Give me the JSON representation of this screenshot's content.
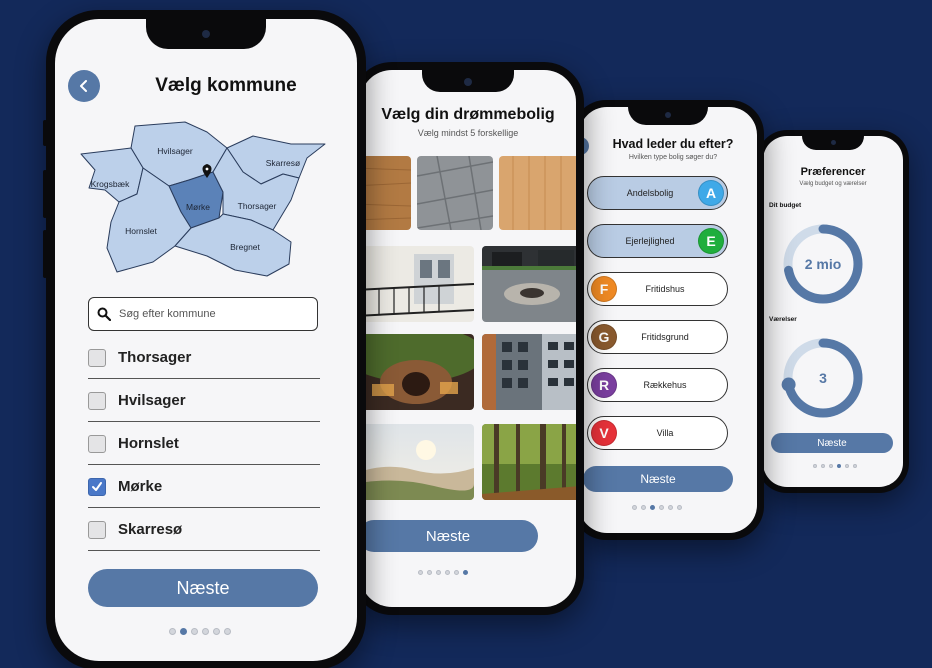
{
  "colors": {
    "background": "#13295a",
    "primary": "#5678a6",
    "map_fill": "#bcd0ea",
    "map_selected": "#5b82b8"
  },
  "screen1": {
    "title": "Vælg kommune",
    "back_icon": "chevron-left-icon",
    "map_regions": [
      "Hvilsager",
      "Skarresø",
      "Krogsbæk",
      "Mørke",
      "Thorsager",
      "Hornslet",
      "Bregnet"
    ],
    "map_pin_icon": "map-pin-icon",
    "search_placeholder": "Søg efter kommune",
    "search_icon": "search-icon",
    "items": [
      {
        "label": "Thorsager",
        "checked": false
      },
      {
        "label": "Hvilsager",
        "checked": false
      },
      {
        "label": "Hornslet",
        "checked": false
      },
      {
        "label": "Mørke",
        "checked": true
      },
      {
        "label": "Skarresø",
        "checked": false
      }
    ],
    "next_label": "Næste",
    "progress": {
      "total": 6,
      "active": 1
    }
  },
  "screen2": {
    "title": "Vælg din drømmebolig",
    "subtitle": "Vælg mindst 5 forskellige",
    "next_label": "Næste",
    "progress": {
      "total": 6,
      "active": 5
    }
  },
  "screen3": {
    "title": "Hvad leder du efter?",
    "subtitle": "Hvilken type bolig søger du?",
    "options": [
      {
        "label": "Andelsbolig",
        "letter": "A",
        "color": "#3fa9e8",
        "selected": true,
        "badge_side": "right"
      },
      {
        "label": "Ejerlejlighed",
        "letter": "E",
        "color": "#1fae3d",
        "selected": true,
        "badge_side": "right"
      },
      {
        "label": "Fritidshus",
        "letter": "F",
        "color": "#f08a24",
        "selected": false,
        "badge_side": "left"
      },
      {
        "label": "Fritidsgrund",
        "letter": "G",
        "color": "#8a5a2e",
        "selected": false,
        "badge_side": "left"
      },
      {
        "label": "Rækkehus",
        "letter": "R",
        "color": "#7b3fa0",
        "selected": false,
        "badge_side": "left"
      },
      {
        "label": "Villa",
        "letter": "V",
        "color": "#e8323a",
        "selected": false,
        "badge_side": "left"
      }
    ],
    "next_label": "Næste",
    "progress": {
      "total": 6,
      "active": 2
    }
  },
  "screen4": {
    "title": "Præferencer",
    "subtitle": "Vælg budget og værelser",
    "budget_label": "Dit budget",
    "budget_value": "2 mio",
    "budget_fraction": 0.72,
    "rooms_label": "Værelser",
    "rooms_value": "3",
    "rooms_fraction": 0.72,
    "next_label": "Næste",
    "progress": {
      "total": 6,
      "active": 3
    }
  }
}
